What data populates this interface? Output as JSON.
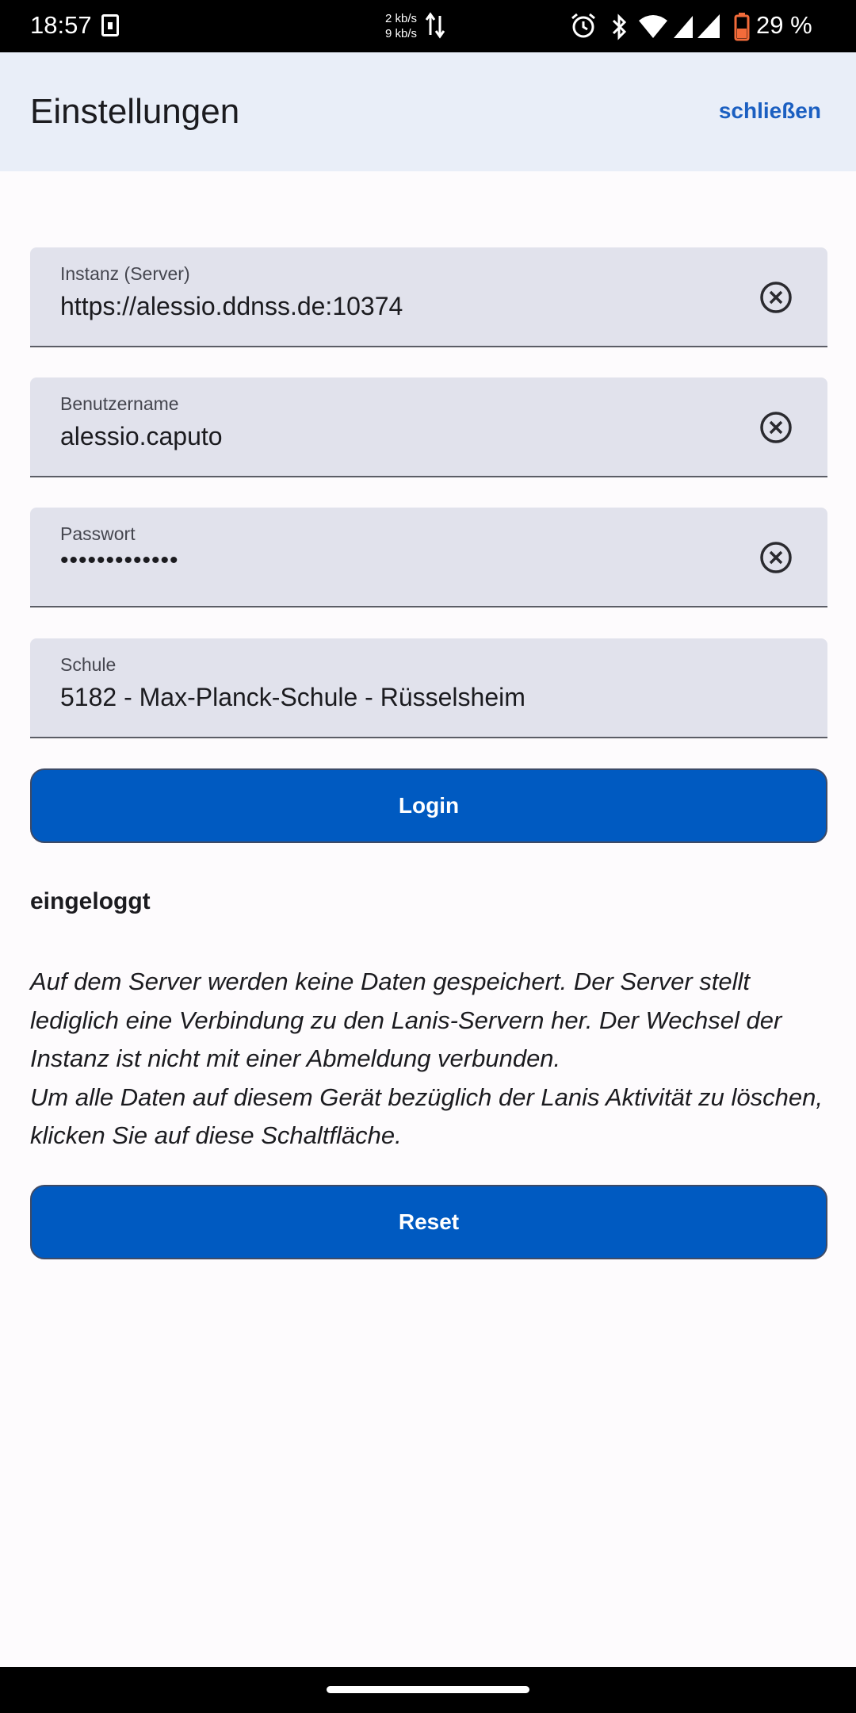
{
  "status_bar": {
    "time": "18:57",
    "net_up": "2 kb/s",
    "net_down": "9 kb/s",
    "battery_pct": "29 %"
  },
  "app_bar": {
    "title": "Einstellungen",
    "close_label": "schließen"
  },
  "form": {
    "instance": {
      "label": "Instanz (Server)",
      "value": "https://alessio.ddnss.de:10374"
    },
    "username": {
      "label": "Benutzername",
      "value": "alessio.caputo"
    },
    "password": {
      "label": "Passwort",
      "value": "•••••••••••••"
    },
    "school": {
      "label": "Schule",
      "value": "5182 - Max-Planck-Schule - Rüsselsheim"
    }
  },
  "login_button": "Login",
  "status": "eingeloggt",
  "info_lines": [
    "Auf dem Server werden keine Daten gespeichert. Der Server stellt",
    "lediglich eine Verbindung zu den Lanis-Servern her. Der Wechsel der",
    "Instanz ist nicht mit einer Abmeldung verbunden.",
    "Um alle Daten auf diesem Gerät bezüglich der Lanis Aktivität zu löschen,",
    "klicken Sie auf diese Schaltfläche."
  ],
  "reset_button": "Reset",
  "colors": {
    "primary": "#005ac1",
    "app_bar_bg": "#e9eef8",
    "field_bg": "#e1e2ec",
    "link": "#1b5fc1"
  }
}
